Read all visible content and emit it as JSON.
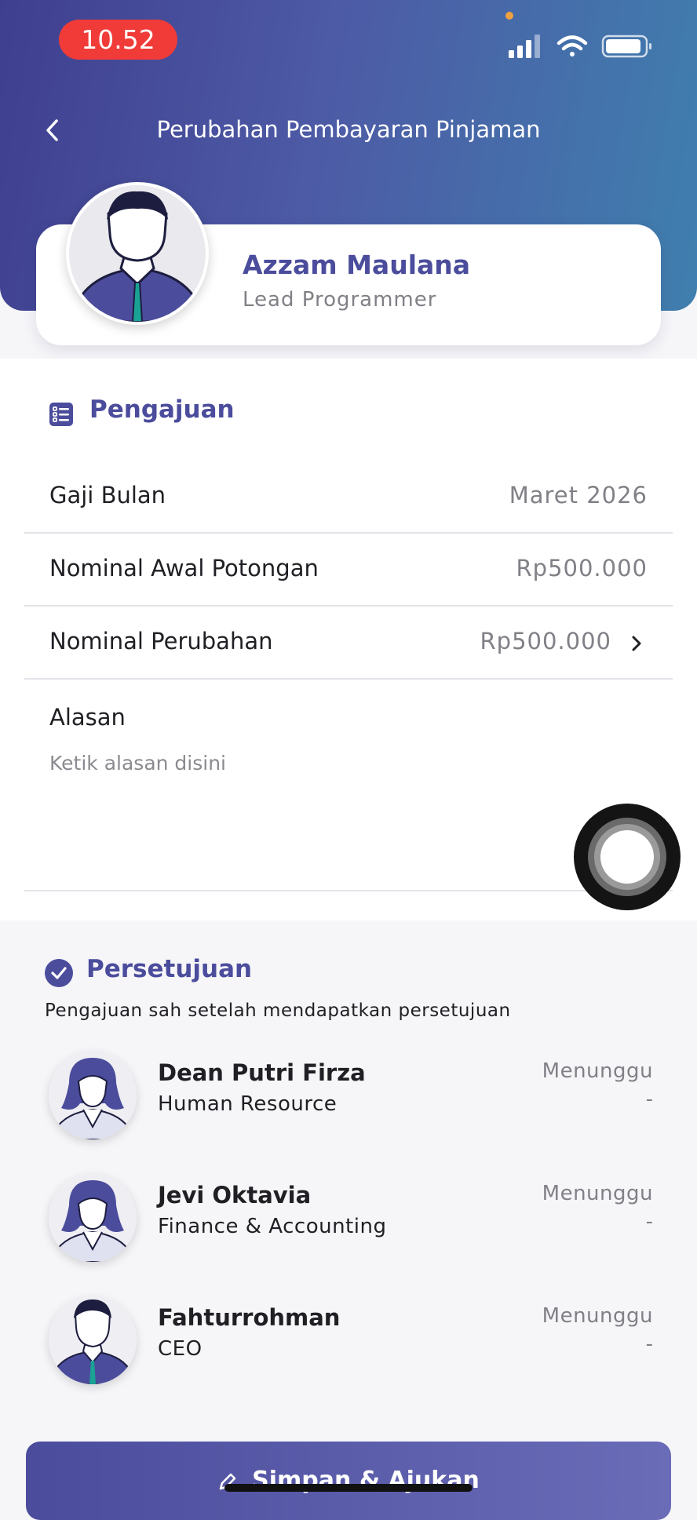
{
  "status_bar": {
    "time": "10.52"
  },
  "header": {
    "title": "Perubahan Pembayaran Pinjaman"
  },
  "profile": {
    "name": "Azzam Maulana",
    "role": "Lead Programmer"
  },
  "form": {
    "section_title": "Pengajuan",
    "salary_month_label": "Gaji Bulan",
    "salary_month_value": "Maret 2026",
    "initial_deduction_label": "Nominal Awal Potongan",
    "initial_deduction_value": "Rp500.000",
    "change_amount_label": "Nominal Perubahan",
    "change_amount_value": "Rp500.000",
    "reason_label": "Alasan",
    "reason_placeholder": "Ketik alasan disini",
    "reason_value": ""
  },
  "approval": {
    "section_title": "Persetujuan",
    "description": "Pengajuan sah setelah mendapatkan persetujuan",
    "approvers": [
      {
        "name": "Dean Putri Firza",
        "department": "Human Resource",
        "status": "Menunggu",
        "date": "-"
      },
      {
        "name": "Jevi Oktavia",
        "department": "Finance & Accounting",
        "status": "Menunggu",
        "date": "-"
      },
      {
        "name": "Fahturrohman",
        "department": "CEO",
        "status": "Menunggu",
        "date": "-"
      }
    ]
  },
  "actions": {
    "submit_label": "Simpan & Ajukan"
  },
  "colors": {
    "accent": "#4b4c9c",
    "status_time_bg": "#f03b38"
  },
  "icons": [
    "back-chevron-icon",
    "signal-icon",
    "wifi-icon",
    "battery-icon",
    "list-icon",
    "check-circle-icon",
    "chevron-right-icon",
    "pencil-icon",
    "assistive-touch-icon"
  ]
}
